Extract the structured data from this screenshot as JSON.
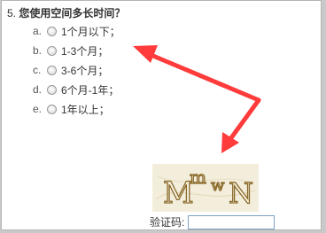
{
  "question": {
    "number": "5.",
    "text": "您使用空间多长时间？"
  },
  "options": [
    {
      "letter": "a.",
      "label": "1个月以下；"
    },
    {
      "letter": "b.",
      "label": "1-3个月；"
    },
    {
      "letter": "c.",
      "label": "3-6个月；"
    },
    {
      "letter": "d.",
      "label": "6个月-1年；"
    },
    {
      "letter": "e.",
      "label": "1年以上；"
    }
  ],
  "captcha": {
    "image_text": "MmwN",
    "label": "验证码:",
    "input_value": ""
  },
  "colors": {
    "arrow": "#ff3b3b",
    "captcha_text": "#8a6a2a",
    "captcha_bg": "#f3eedc"
  }
}
